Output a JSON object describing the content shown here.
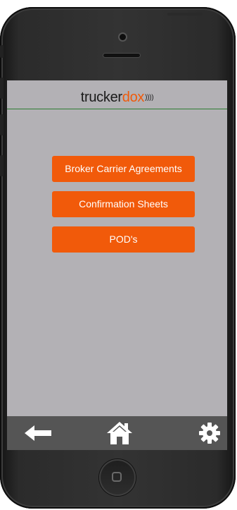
{
  "header": {
    "logo_part1": "trucker",
    "logo_part2": "dox",
    "logo_waves": "))))"
  },
  "menu": {
    "items": [
      {
        "label": "Broker Carrier Agreements"
      },
      {
        "label": "Confirmation Sheets"
      },
      {
        "label": "POD's"
      }
    ]
  },
  "bottom_nav": {
    "icons": [
      "back-arrow-icon",
      "home-icon",
      "settings-gear-icon"
    ]
  },
  "colors": {
    "accent": "#f15a0a",
    "screen_bg": "#b3b1b5",
    "nav_bg": "#555555",
    "header_rule": "#2e7d32"
  }
}
